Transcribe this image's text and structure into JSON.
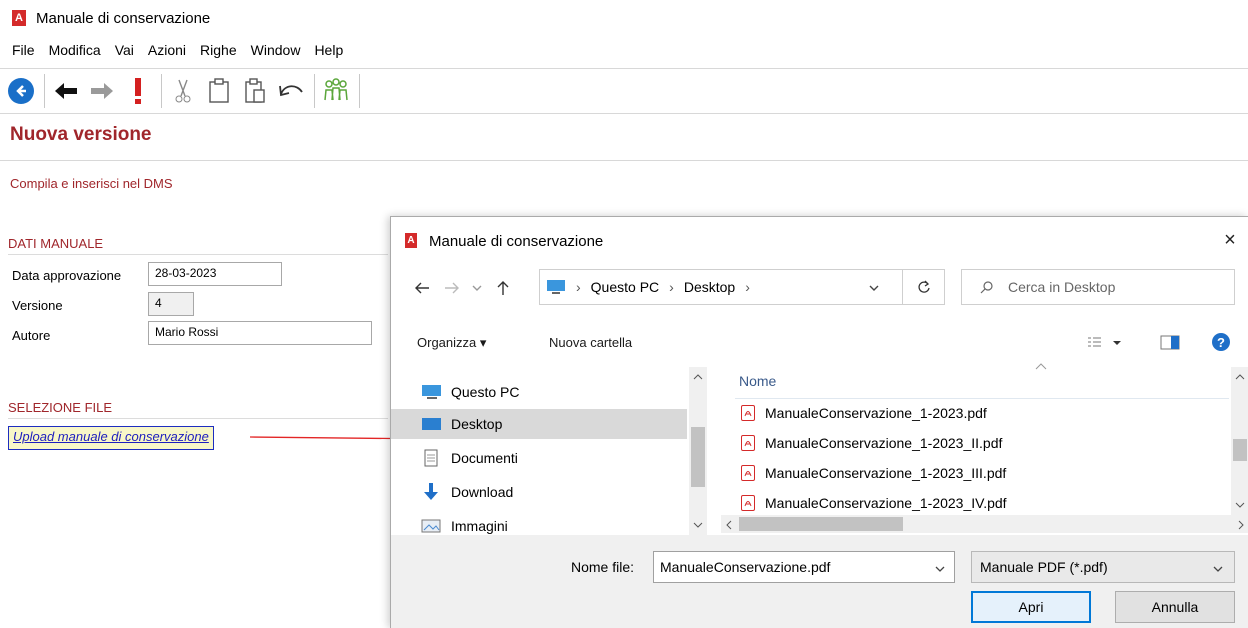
{
  "window": {
    "title": "Manuale di conservazione",
    "logo_letter": "A"
  },
  "menu": [
    "File",
    "Modifica",
    "Vai",
    "Azioni",
    "Righe",
    "Window",
    "Help"
  ],
  "toolbar_icons": [
    "back-circle-icon",
    "arrow-left-icon",
    "arrow-right-icon",
    "exclamation-icon",
    "scissors-icon",
    "clipboard-icon",
    "paste-icon",
    "undo-icon",
    "people-icon"
  ],
  "page": {
    "title": "Nuova versione",
    "subtitle": "Compila e inserisci nel DMS"
  },
  "dati_manuale": {
    "header": "DATI MANUALE",
    "fields": [
      {
        "label": "Data approvazione",
        "value": "28-03-2023"
      },
      {
        "label": "Versione",
        "value": "4"
      },
      {
        "label": "Autore",
        "value": "Mario Rossi"
      }
    ]
  },
  "selezione_file": {
    "header": "SELEZIONE FILE",
    "link": "Upload manuale di conservazione"
  },
  "dialog": {
    "title": "Manuale di conservazione",
    "logo_letter": "A",
    "close_glyph": "×",
    "address": {
      "crumbs": [
        "Questo PC",
        "Desktop"
      ],
      "separator": "›"
    },
    "search_placeholder": "Cerca in Desktop",
    "commands": {
      "organize": "Organizza ▾",
      "new_folder": "Nuova cartella"
    },
    "nav": [
      {
        "label": "Questo PC",
        "icon": "monitor-icon"
      },
      {
        "label": "Desktop",
        "icon": "desktop-icon",
        "selected": true
      },
      {
        "label": "Documenti",
        "icon": "document-icon"
      },
      {
        "label": "Download",
        "icon": "download-icon"
      },
      {
        "label": "Immagini",
        "icon": "image-icon"
      }
    ],
    "column_header": "Nome",
    "files": [
      "ManualeConservazione_1-2023.pdf",
      "ManualeConservazione_1-2023_II.pdf",
      "ManualeConservazione_1-2023_III.pdf",
      "ManualeConservazione_1-2023_IV.pdf"
    ],
    "file_name_label": "Nome file:",
    "file_name_value": "ManualeConservazione.pdf",
    "filter": "Manuale PDF (*.pdf)",
    "open_button": "Apri",
    "cancel_button": "Annulla"
  },
  "colors": {
    "accent": "#a0262b",
    "link": "#1d1dbf",
    "link_bg": "#f8f7c8",
    "arrow": "#e32626",
    "selection": "#d9d9d9"
  }
}
